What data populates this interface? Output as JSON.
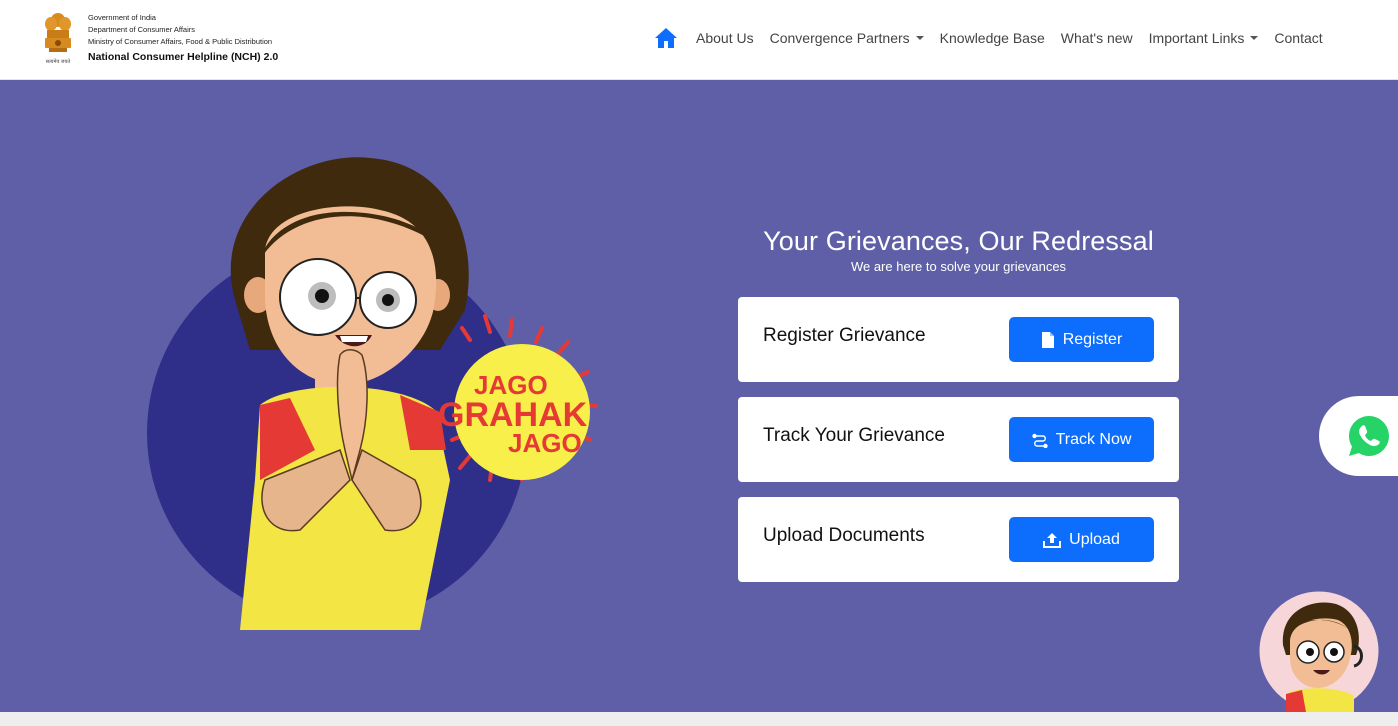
{
  "header": {
    "emblem_icon": "ashoka-emblem-icon",
    "brand_lines": [
      "Government of India",
      "Department of Consumer Affairs",
      "Ministry of Consumer Affairs, Food & Public Distribution"
    ],
    "brand_title": "National Consumer Helpline (NCH) 2.0",
    "emblem_caption": "सत्यमेव जयते"
  },
  "nav": {
    "home_icon": "home-icon",
    "items": [
      {
        "label": "About Us",
        "dropdown": false
      },
      {
        "label": "Convergence Partners",
        "dropdown": true
      },
      {
        "label": "Knowledge Base",
        "dropdown": false
      },
      {
        "label": "What's new",
        "dropdown": false
      },
      {
        "label": "Important Links",
        "dropdown": true
      },
      {
        "label": "Contact",
        "dropdown": false
      }
    ]
  },
  "hero": {
    "title": "Your Grievances, Our Redressal",
    "subtitle": "We are here to solve your grievances",
    "badge_lines": [
      "JAGO",
      "GRAHAK",
      "JAGO"
    ],
    "cards": [
      {
        "label": "Register Grievance",
        "button": "Register",
        "icon": "document-icon"
      },
      {
        "label": "Track Your Grievance",
        "button": "Track Now",
        "icon": "route-icon"
      },
      {
        "label": "Upload Documents",
        "button": "Upload",
        "icon": "upload-icon"
      }
    ]
  },
  "colors": {
    "hero_bg": "#5f5fa8",
    "primary_button": "#0d6efd",
    "whatsapp": "#25d366",
    "badge_yellow": "#f8ef4a",
    "badge_red": "#e53935"
  }
}
